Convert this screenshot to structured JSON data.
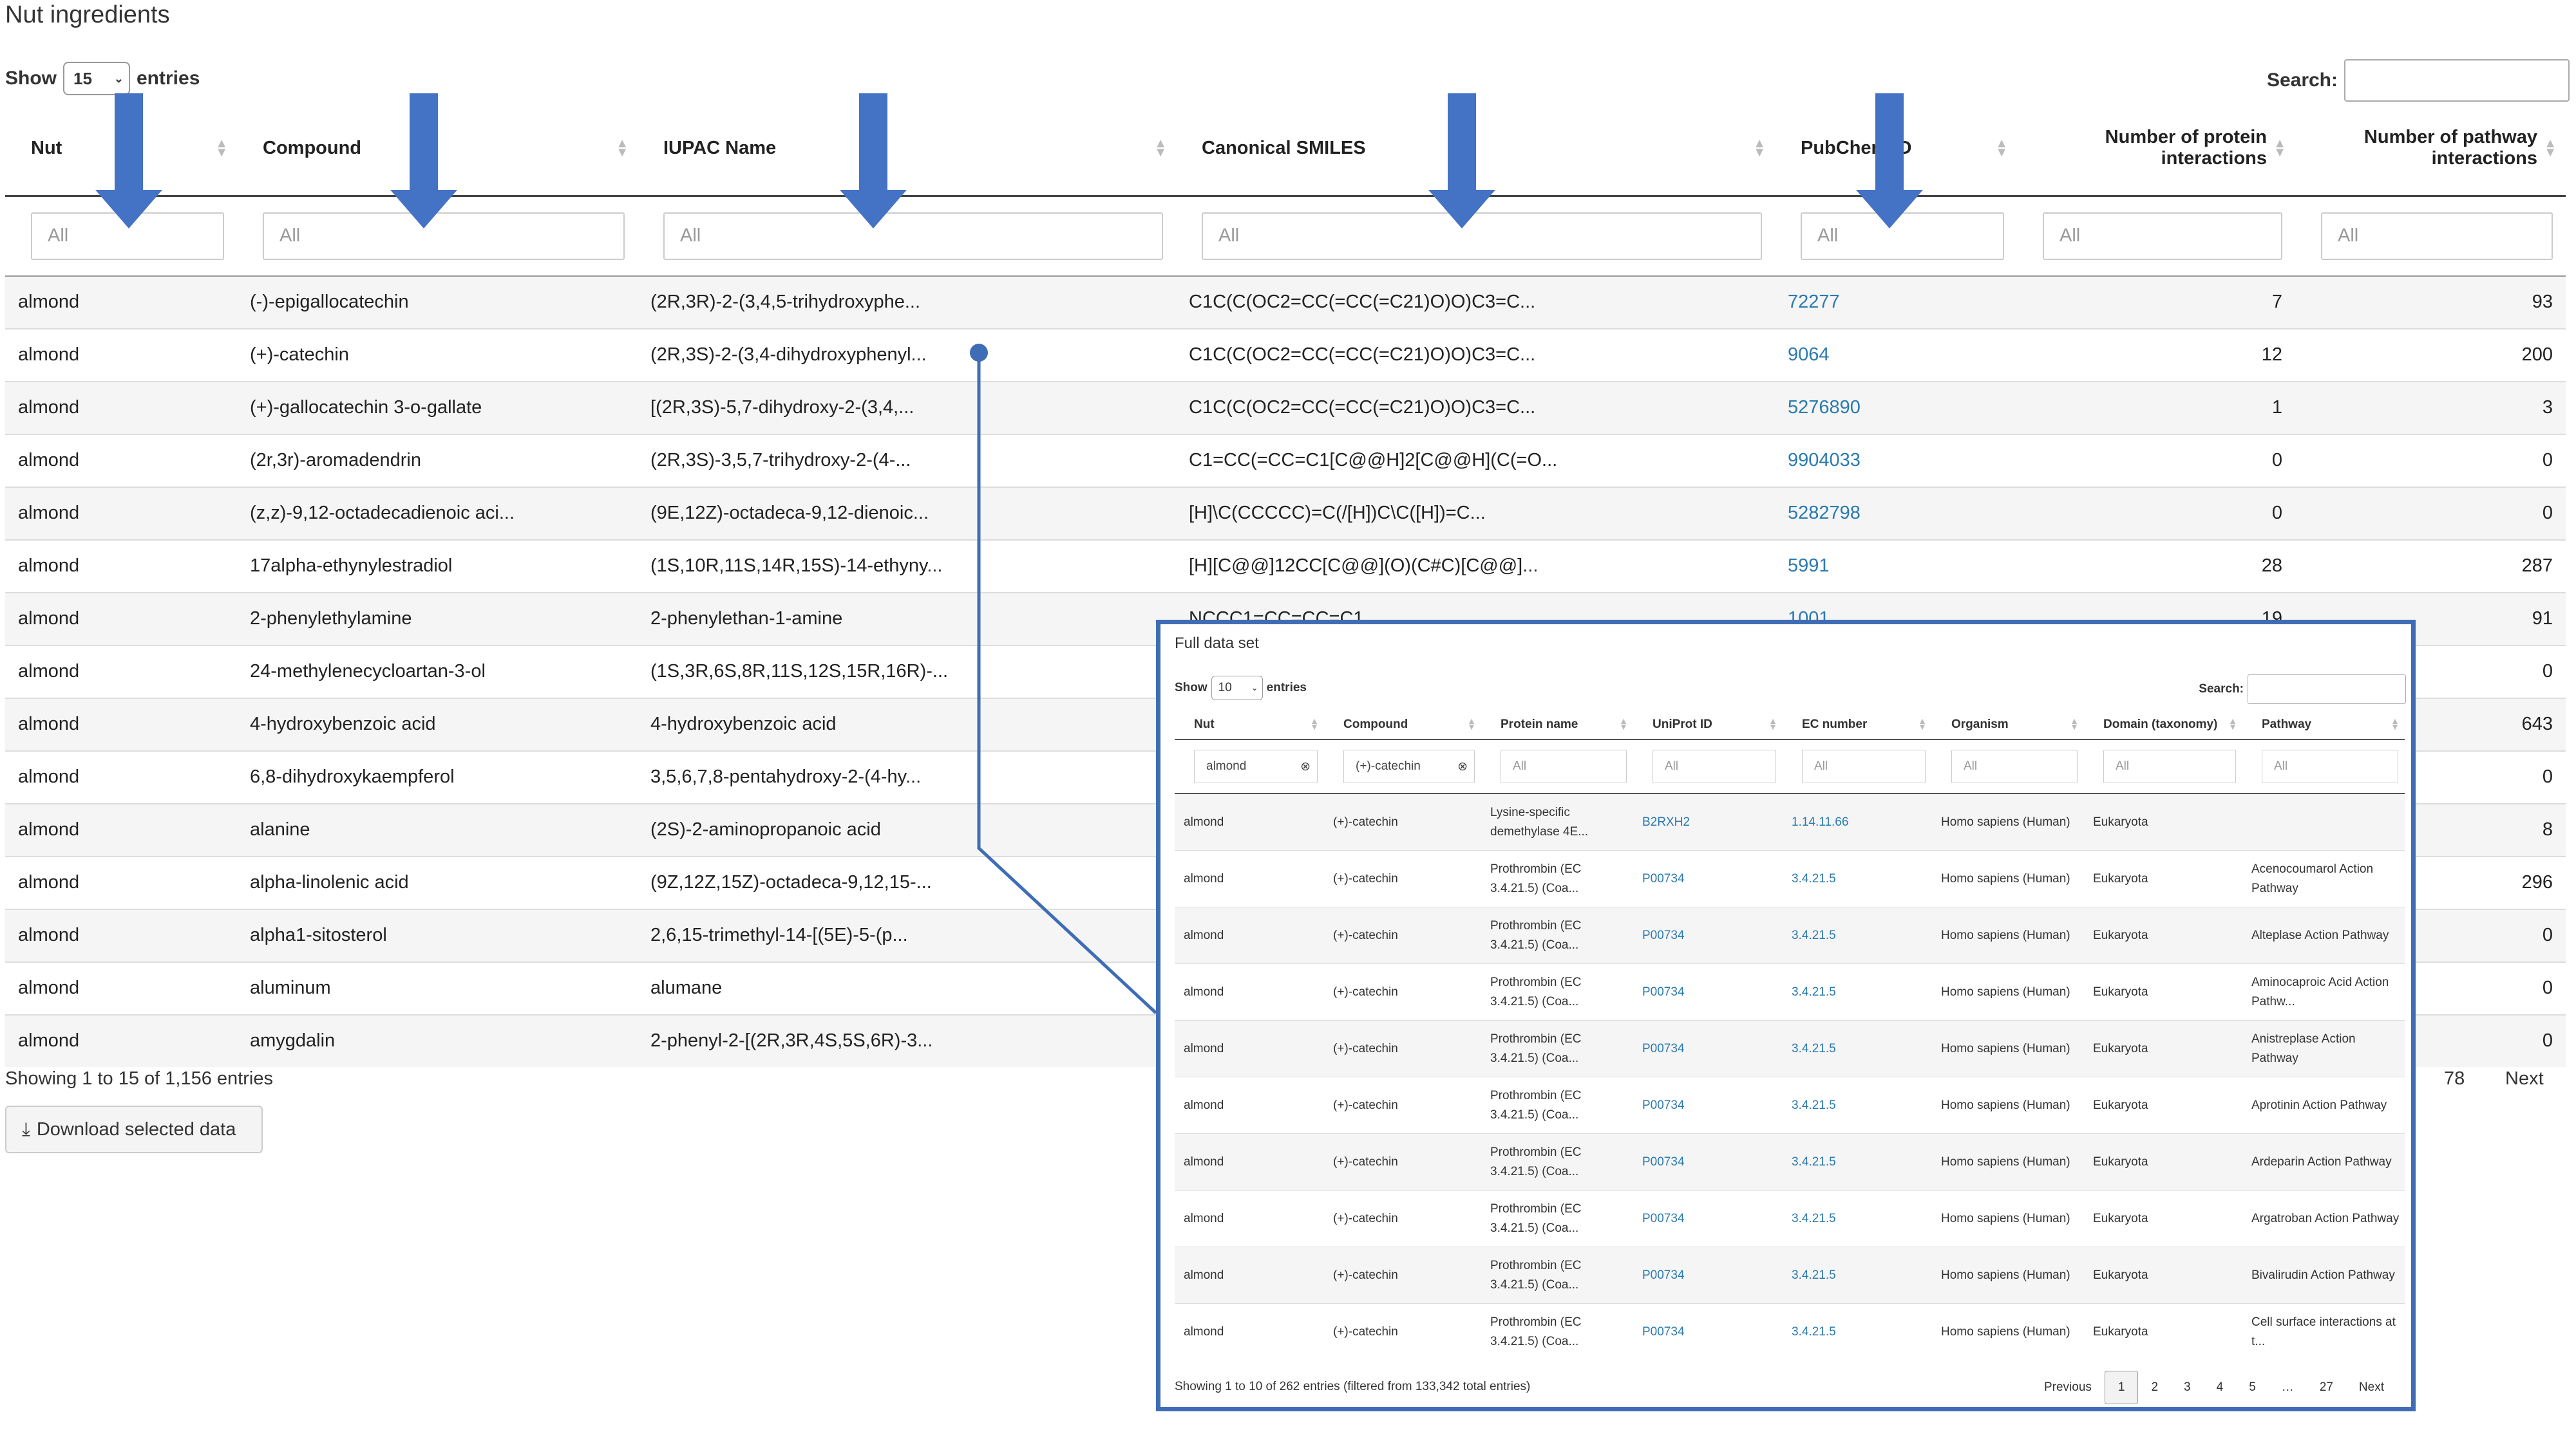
{
  "page_title": "Nut ingredients",
  "length_control": {
    "show_label": "Show",
    "value": "15",
    "entries_label": "entries"
  },
  "search": {
    "label": "Search:",
    "value": ""
  },
  "columns": [
    "Nut",
    "Compound",
    "IUPAC Name",
    "Canonical SMILES",
    "PubChem ID",
    "Number of protein interactions",
    "Number of pathway interactions"
  ],
  "filter_placeholder": "All",
  "rows": [
    [
      "almond",
      "(-)-epigallocatechin",
      "(2R,3R)-2-(3,4,5-trihydroxyphe...",
      "C1C(C(OC2=CC(=CC(=C21)O)O)C3=C...",
      "72277",
      "7",
      "93"
    ],
    [
      "almond",
      "(+)-catechin",
      "(2R,3S)-2-(3,4-dihydroxyphenyl...",
      "C1C(C(OC2=CC(=CC(=C21)O)O)C3=C...",
      "9064",
      "12",
      "200"
    ],
    [
      "almond",
      "(+)-gallocatechin 3-o-gallate",
      "[(2R,3S)-5,7-dihydroxy-2-(3,4,...",
      "C1C(C(OC2=CC(=CC(=C21)O)O)C3=C...",
      "5276890",
      "1",
      "3"
    ],
    [
      "almond",
      "(2r,3r)-aromadendrin",
      "(2R,3S)-3,5,7-trihydroxy-2-(4-...",
      "C1=CC(=CC=C1[C@@H]2[C@@H](C(=O...",
      "9904033",
      "0",
      "0"
    ],
    [
      "almond",
      "(z,z)-9,12-octadecadienoic aci...",
      "(9E,12Z)-octadeca-9,12-dienoic...",
      "[H]\\C(CCCCC)=C(/[H])C\\C([H])=C...",
      "5282798",
      "0",
      "0"
    ],
    [
      "almond",
      "17alpha-ethynylestradiol",
      "(1S,10R,11S,14R,15S)-14-ethyny...",
      "[H][C@@]12CC[C@@](O)(C#C)[C@@]...",
      "5991",
      "28",
      "287"
    ],
    [
      "almond",
      "2-phenylethylamine",
      "2-phenylethan-1-amine",
      "NCCC1=CC=CC=C1",
      "1001",
      "19",
      "91"
    ],
    [
      "almond",
      "24-methylenecycloartan-3-ol",
      "(1S,3R,6S,8R,11S,12S,15R,16R)-...",
      "",
      "",
      "",
      "0"
    ],
    [
      "almond",
      "4-hydroxybenzoic acid",
      "4-hydroxybenzoic acid",
      "",
      "",
      "",
      "643"
    ],
    [
      "almond",
      "6,8-dihydroxykaempferol",
      "3,5,6,7,8-pentahydroxy-2-(4-hy...",
      "",
      "",
      "",
      "0"
    ],
    [
      "almond",
      "alanine",
      "(2S)-2-aminopropanoic acid",
      "",
      "",
      "",
      "8"
    ],
    [
      "almond",
      "alpha-linolenic acid",
      "(9Z,12Z,15Z)-octadeca-9,12,15-...",
      "",
      "",
      "",
      "296"
    ],
    [
      "almond",
      "alpha1-sitosterol",
      "2,6,15-trimethyl-14-[(5E)-5-(p...",
      "",
      "",
      "",
      "0"
    ],
    [
      "almond",
      "aluminum",
      "alumane",
      "",
      "",
      "",
      "0"
    ],
    [
      "almond",
      "amygdalin",
      "2-phenyl-2-[(2R,3R,4S,5S,6R)-3...",
      "",
      "",
      "",
      "0"
    ]
  ],
  "info": "Showing 1 to 15 of 1,156 entries",
  "download_label": "Download selected data",
  "pager": {
    "last": "78",
    "next": "Next"
  },
  "overlay": {
    "title": "Full data set",
    "length": {
      "show_label": "Show",
      "value": "10",
      "entries_label": "entries"
    },
    "search_label": "Search:",
    "columns": [
      "Nut",
      "Compound",
      "Protein name",
      "UniProt ID",
      "EC number",
      "Organism",
      "Domain (taxonomy)",
      "Pathway"
    ],
    "filters": [
      "almond",
      "(+)-catechin",
      "All",
      "All",
      "All",
      "All",
      "All",
      "All"
    ],
    "rows": [
      [
        "almond",
        "(+)-catechin",
        "Lysine-specific demethylase 4E...",
        "B2RXH2",
        "1.14.11.66",
        "Homo sapiens (Human)",
        "Eukaryota",
        ""
      ],
      [
        "almond",
        "(+)-catechin",
        "Prothrombin (EC 3.4.21.5) (Coa...",
        "P00734",
        "3.4.21.5",
        "Homo sapiens (Human)",
        "Eukaryota",
        "Acenocoumarol Action Pathway"
      ],
      [
        "almond",
        "(+)-catechin",
        "Prothrombin (EC 3.4.21.5) (Coa...",
        "P00734",
        "3.4.21.5",
        "Homo sapiens (Human)",
        "Eukaryota",
        "Alteplase Action Pathway"
      ],
      [
        "almond",
        "(+)-catechin",
        "Prothrombin (EC 3.4.21.5) (Coa...",
        "P00734",
        "3.4.21.5",
        "Homo sapiens (Human)",
        "Eukaryota",
        "Aminocaproic Acid Action Pathw..."
      ],
      [
        "almond",
        "(+)-catechin",
        "Prothrombin (EC 3.4.21.5) (Coa...",
        "P00734",
        "3.4.21.5",
        "Homo sapiens (Human)",
        "Eukaryota",
        "Anistreplase Action Pathway"
      ],
      [
        "almond",
        "(+)-catechin",
        "Prothrombin (EC 3.4.21.5) (Coa...",
        "P00734",
        "3.4.21.5",
        "Homo sapiens (Human)",
        "Eukaryota",
        "Aprotinin Action Pathway"
      ],
      [
        "almond",
        "(+)-catechin",
        "Prothrombin (EC 3.4.21.5) (Coa...",
        "P00734",
        "3.4.21.5",
        "Homo sapiens (Human)",
        "Eukaryota",
        "Ardeparin Action Pathway"
      ],
      [
        "almond",
        "(+)-catechin",
        "Prothrombin (EC 3.4.21.5) (Coa...",
        "P00734",
        "3.4.21.5",
        "Homo sapiens (Human)",
        "Eukaryota",
        "Argatroban Action Pathway"
      ],
      [
        "almond",
        "(+)-catechin",
        "Prothrombin (EC 3.4.21.5) (Coa...",
        "P00734",
        "3.4.21.5",
        "Homo sapiens (Human)",
        "Eukaryota",
        "Bivalirudin Action Pathway"
      ],
      [
        "almond",
        "(+)-catechin",
        "Prothrombin (EC 3.4.21.5) (Coa...",
        "P00734",
        "3.4.21.5",
        "Homo sapiens (Human)",
        "Eukaryota",
        "Cell surface interactions at t..."
      ]
    ],
    "info": "Showing 1 to 10 of 262 entries (filtered from 133,342 total entries)",
    "pager": [
      "Previous",
      "1",
      "2",
      "3",
      "4",
      "5",
      "…",
      "27",
      "Next"
    ]
  },
  "colors": {
    "link": "#2a7ab0",
    "arrow": "#4472c4",
    "overlay_border": "#3f6db5"
  }
}
